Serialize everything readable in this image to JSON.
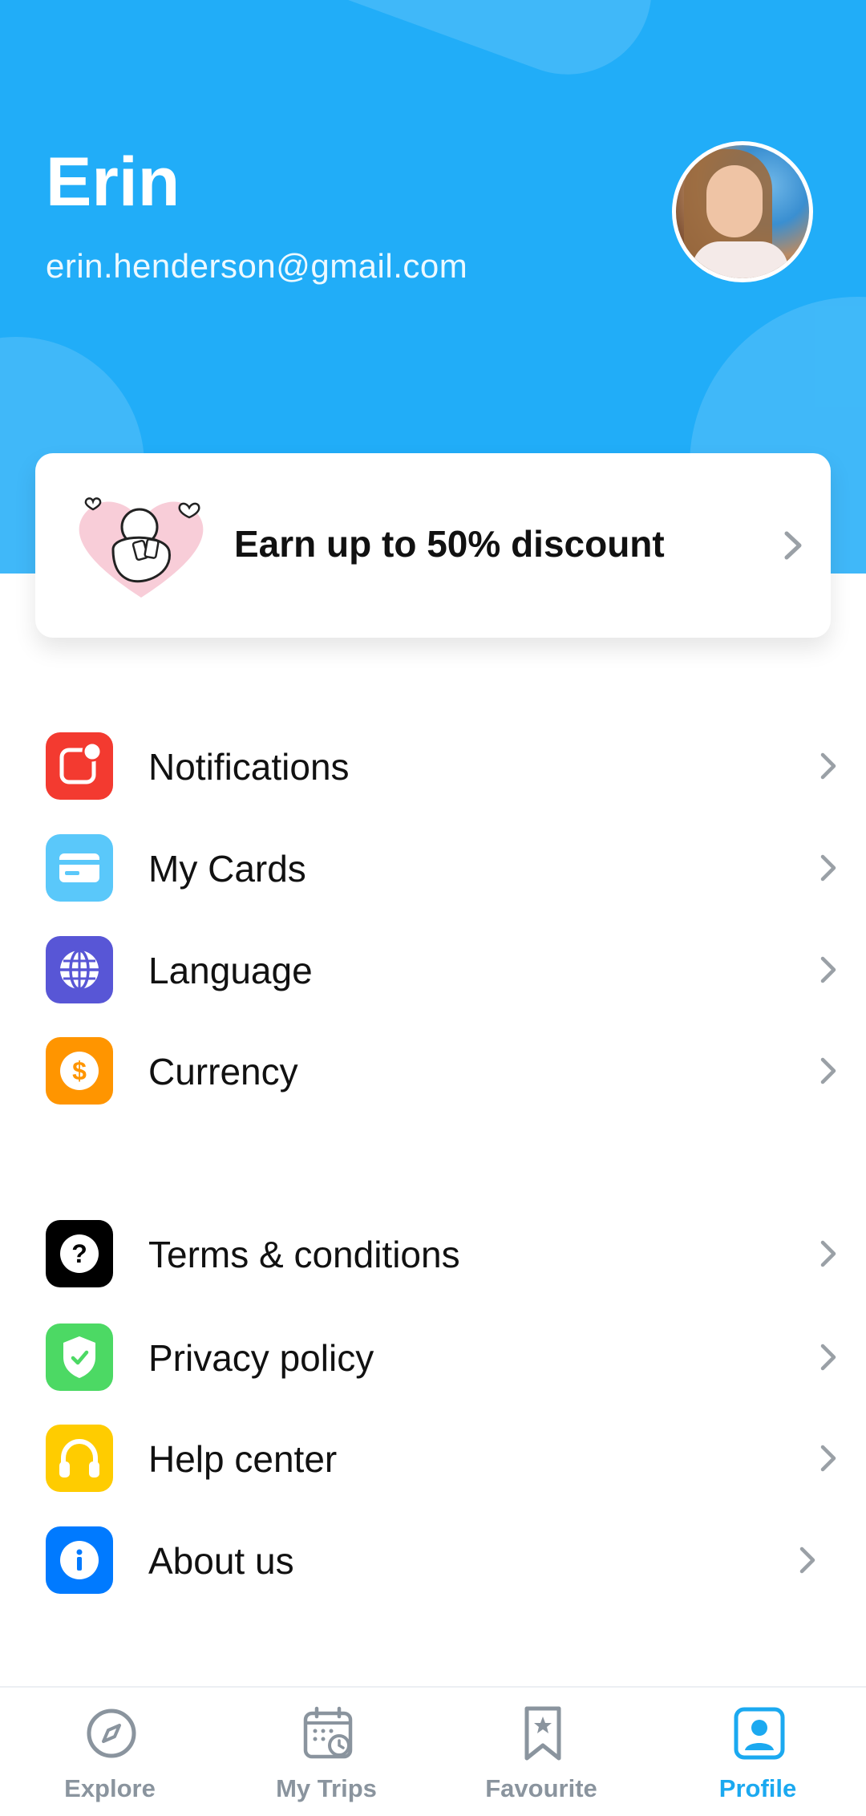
{
  "profile": {
    "name": "Erin",
    "email": "erin.henderson@gmail.com"
  },
  "promo": {
    "label": "Earn up to 50% discount"
  },
  "menu_group_1": [
    {
      "label": "Notifications",
      "icon": "notification-icon",
      "color": "#f33a30"
    },
    {
      "label": "My Cards",
      "icon": "card-icon",
      "color": "#5ac8fa"
    },
    {
      "label": "Language",
      "icon": "globe-icon",
      "color": "#5856d6"
    },
    {
      "label": "Currency",
      "icon": "dollar-icon",
      "color": "#ff9500"
    }
  ],
  "menu_group_2": [
    {
      "label": "Terms & conditions",
      "icon": "question-icon",
      "color": "#000000"
    },
    {
      "label": "Privacy policy",
      "icon": "shield-icon",
      "color": "#4cd964"
    },
    {
      "label": "Help center",
      "icon": "headphones-icon",
      "color": "#ffcc00"
    },
    {
      "label": "About us",
      "icon": "info-icon",
      "color": "#007aff"
    }
  ],
  "tabs": [
    {
      "label": "Explore",
      "icon": "compass-icon",
      "active": false
    },
    {
      "label": "My Trips",
      "icon": "calendar-icon",
      "active": false
    },
    {
      "label": "Favourite",
      "icon": "bookmark-icon",
      "active": false
    },
    {
      "label": "Profile",
      "icon": "profile-icon",
      "active": true
    }
  ],
  "colors": {
    "header_bg": "#21adf8",
    "active_tab": "#1ba9f0",
    "inactive_tab": "#8a949e"
  }
}
